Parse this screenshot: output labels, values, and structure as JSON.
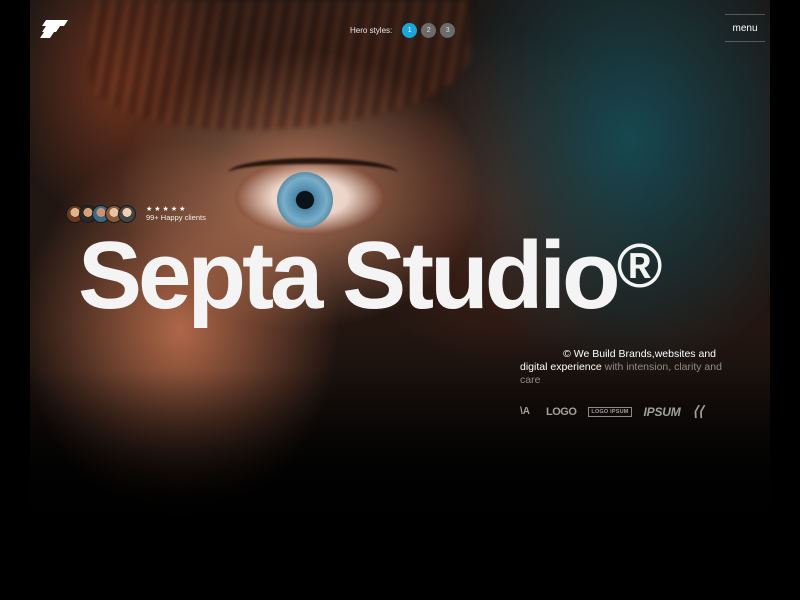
{
  "header": {
    "hero_styles_label": "Hero styles:",
    "hero_style_options": [
      "1",
      "2",
      "3"
    ],
    "active_hero_style": "1",
    "menu_label": "menu"
  },
  "social_proof": {
    "stars": "★★★★★",
    "clients_text": "99+ Happy clients"
  },
  "hero": {
    "title": "Septa Studio",
    "registered_mark": "®",
    "tagline_line1": "© We Build Brands,websites and",
    "tagline_highlight": "digital experience",
    "tagline_muted": "with intension, clarity and care"
  },
  "brands": [
    "\\A",
    "LOGO",
    "LOGO IPSUM",
    "IPSUM",
    "⟨⟨"
  ],
  "colors": {
    "accent": "#1aa6d8",
    "title": "#f4f4f4",
    "muted_text": "#8d8d8d"
  },
  "icons": {
    "logo": "studio-logo-icon"
  }
}
